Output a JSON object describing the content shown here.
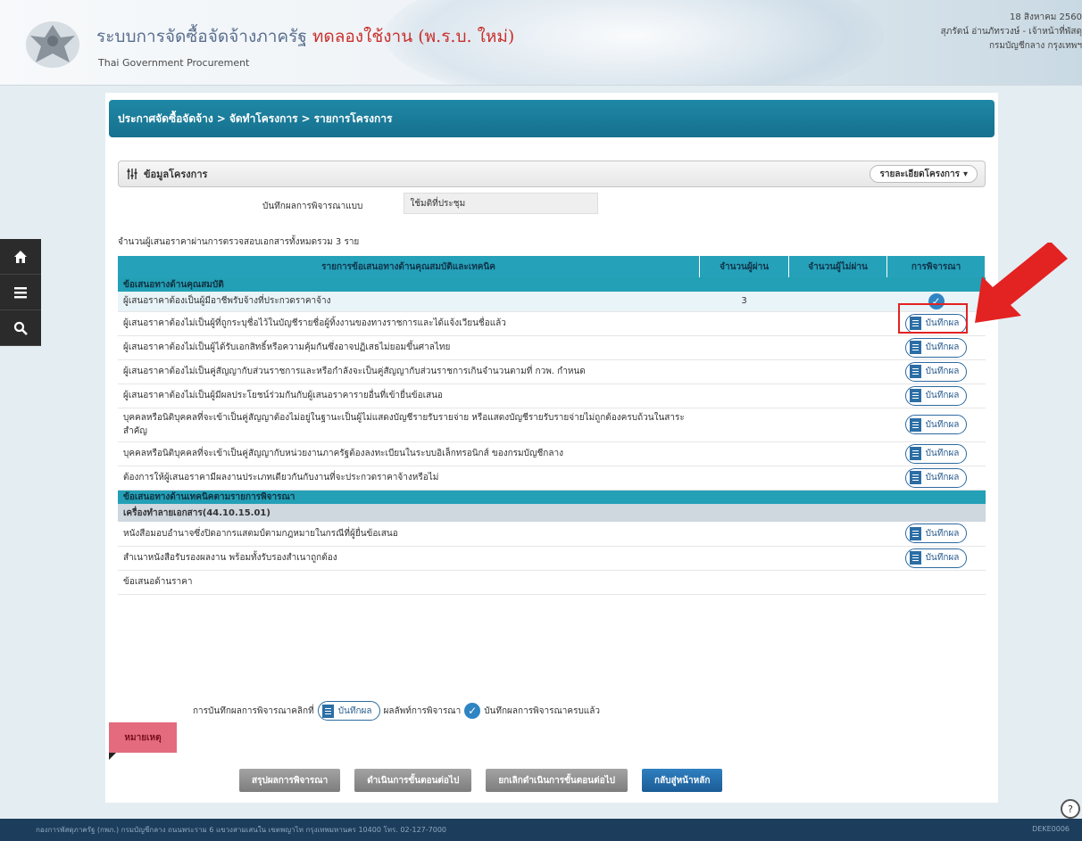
{
  "header": {
    "title_main": "ระบบการจัดซื้อจัดจ้างภาครัฐ",
    "title_trial": "ทดลองใช้งาน (พ.ร.บ. ใหม่)",
    "subtitle": "Thai Government Procurement",
    "date": "18 สิงหาคม 2560",
    "user": "สุภรัตน์ อ่านภัทรวงษ์ - เจ้าหน้าที่พัสดุ",
    "department": "กรมบัญชีกลาง กรุงเทพฯ"
  },
  "rail": {
    "icons": [
      "home-icon",
      "menu-icon",
      "search-icon"
    ]
  },
  "breadcrumb": {
    "items": [
      "ประกาศจัดซื้อจัดจ้าง",
      "จัดทำโครงการ",
      "รายการโครงการ"
    ],
    "separator": ">"
  },
  "section": {
    "title": "ข้อมูลโครงการ",
    "details_label": "รายละเอียดโครงการ"
  },
  "method": {
    "label": "บันทึกผลการพิจารณาแบบ",
    "value": "ใช้มติที่ประชุม"
  },
  "bidder_count_text": "จำนวนผู้เสนอราคาผ่านการตรวจสอบเอกสารทั้งหมดรวม 3 ราย",
  "table": {
    "headers": [
      "รายการข้อเสนอทางด้านคุณสมบัติและเทคนิค",
      "จำนวนผู้ผ่าน",
      "จำนวนผู้ไม่ผ่าน",
      "การพิจารณา"
    ],
    "group1": "ข้อเสนอทางด้านคุณสมบัติ",
    "rows1": [
      {
        "text": "ผู้เสนอราคาต้องเป็นผู้มีอาชีพรับจ้างที่ประกวดราคาจ้าง",
        "pass": "3",
        "fail": ""
      },
      {
        "text": "ผู้เสนอราคาต้องไม่เป็นผู้ที่ถูกระบุชื่อไว้ในบัญชีรายชื่อผู้ทิ้งงานของทางราชการและได้แจ้งเวียนชื่อแล้ว"
      },
      {
        "text": "ผู้เสนอราคาต้องไม่เป็นผู้ได้รับเอกสิทธิ์หรือความคุ้มกันซึ่งอาจปฏิเสธไม่ยอมขึ้นศาลไทย"
      },
      {
        "text": "ผู้เสนอราคาต้องไม่เป็นคู่สัญญากับส่วนราชการและหรือกำลังจะเป็นคู่สัญญากับส่วนราชการเกินจำนวนตามที่ กวพ. กำหนด"
      },
      {
        "text": "ผู้เสนอราคาต้องไม่เป็นผู้มีผลประโยชน์ร่วมกันกับผู้เสนอราคารายอื่นที่เข้ายื่นข้อเสนอ"
      },
      {
        "text": "บุคคลหรือนิติบุคคลที่จะเข้าเป็นคู่สัญญาต้องไม่อยู่ในฐานะเป็นผู้ไม่แสดงบัญชีรายรับรายจ่าย หรือแสดงบัญชีรายรับรายจ่ายไม่ถูกต้องครบถ้วนในสาระสำคัญ"
      },
      {
        "text": "บุคคลหรือนิติบุคคลที่จะเข้าเป็นคู่สัญญากับหน่วยงานภาครัฐต้องลงทะเบียนในระบบอิเล็กทรอนิกส์ ของกรมบัญชีกลาง"
      },
      {
        "text": "ต้องการให้ผู้เสนอราคามีผลงานประเภทเดียวกันกับงานที่จะประกวดราคาจ้างหรือไม่"
      }
    ],
    "group2": "ข้อเสนอทางด้านเทคนิคตามรายการพิจารณา",
    "subgroup": "เครื่องทำลายเอกสาร(44.10.15.01)",
    "rows2": [
      {
        "text": "หนังสือมอบอำนาจซึ่งปิดอากรแสตมป์ตามกฎหมายในกรณีที่ผู้ยื่นข้อเสนอ"
      },
      {
        "text": "สำเนาหนังสือรับรองผลงาน พร้อมทั้งรับรองสำเนาถูกต้อง"
      }
    ],
    "price_row": "ข้อเสนอด้านราคา",
    "record_label": "บันทึกผล"
  },
  "remark": {
    "tag": "หมายเหตุ",
    "prefix": "การบันทึกผลการพิจารณาคลิกที่",
    "button": "บันทึกผล",
    "middle": "ผลลัพท์การพิจารณา",
    "suffix": "บันทึกผลการพิจารณาครบแล้ว"
  },
  "actions": {
    "summary": "สรุปผลการพิจารณา",
    "proceed": "ดำเนินการขั้นตอนต่อไป",
    "cancel": "ยกเลิกดำเนินการขั้นตอนต่อไป",
    "home": "กลับสู่หน้าหลัก"
  },
  "footer": {
    "text": "กองการพัสดุภาครัฐ (กพภ.) กรมบัญชีกลาง ถนนพระราม 6 แขวงสามเสนใน เขตพญาไท กรุงเทพมหานคร 10400 โทร. 02-127-7000",
    "code": "DEKE0006"
  },
  "colors": {
    "accent": "#1f88a6",
    "table_header": "#25a1b9",
    "highlight": "#e32222",
    "footer": "#1c3d5c"
  }
}
